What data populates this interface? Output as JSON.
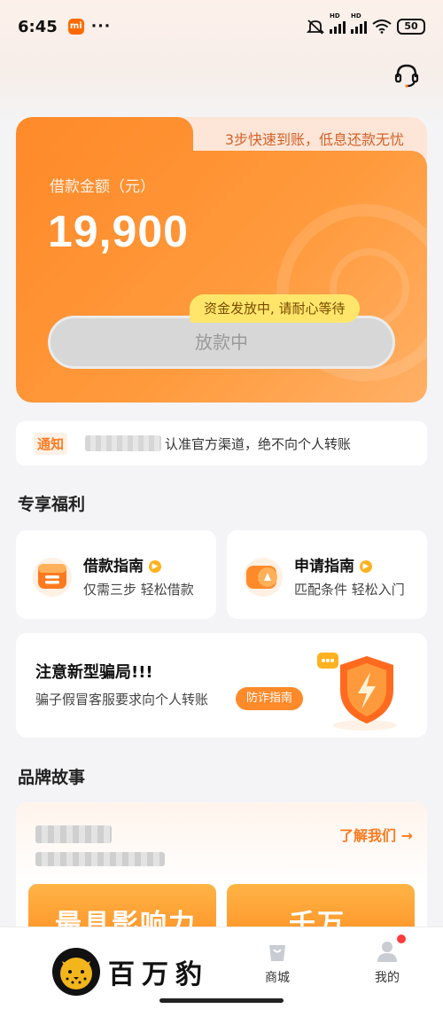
{
  "status_bar": {
    "time": "6:45",
    "battery": "50",
    "hd1": "HD",
    "hd2": "HD"
  },
  "loan_card": {
    "slogan": "3步快速到账，低息还款无忧",
    "amount_label": "借款金额（元）",
    "amount": "19,900",
    "tip": "资金发放中, 请耐心等待",
    "button": "放款中"
  },
  "notice": {
    "tag": "通知",
    "text": "认准官方渠道，绝不向个人转账"
  },
  "benefits": {
    "title": "专享福利",
    "items": [
      {
        "title": "借款指南",
        "subtitle": "仅需三步 轻松借款",
        "icon": "guide-box-icon"
      },
      {
        "title": "申请指南",
        "subtitle": "匹配条件 轻松入门",
        "icon": "apply-ticket-icon"
      }
    ]
  },
  "fraud": {
    "title": "注意新型骗局!!!",
    "subtitle": "骗子假冒客服要求向个人转账",
    "button": "防诈指南",
    "icon": "shield-alert-icon"
  },
  "brand_story": {
    "title": "品牌故事",
    "about_link": "了解我们 →",
    "promo_left": "最具影响力",
    "promo_right": "千万"
  },
  "bottom_nav": {
    "items": [
      {
        "label": "商城",
        "icon": "shopping-bag-icon"
      },
      {
        "label": "我的",
        "icon": "profile-icon"
      }
    ]
  },
  "brand": {
    "name": "百万豹",
    "logo": "leopard-logo"
  },
  "colors": {
    "accent": "#ff8a2a",
    "tip": "#ffe66b",
    "link": "#ff7a1f"
  }
}
